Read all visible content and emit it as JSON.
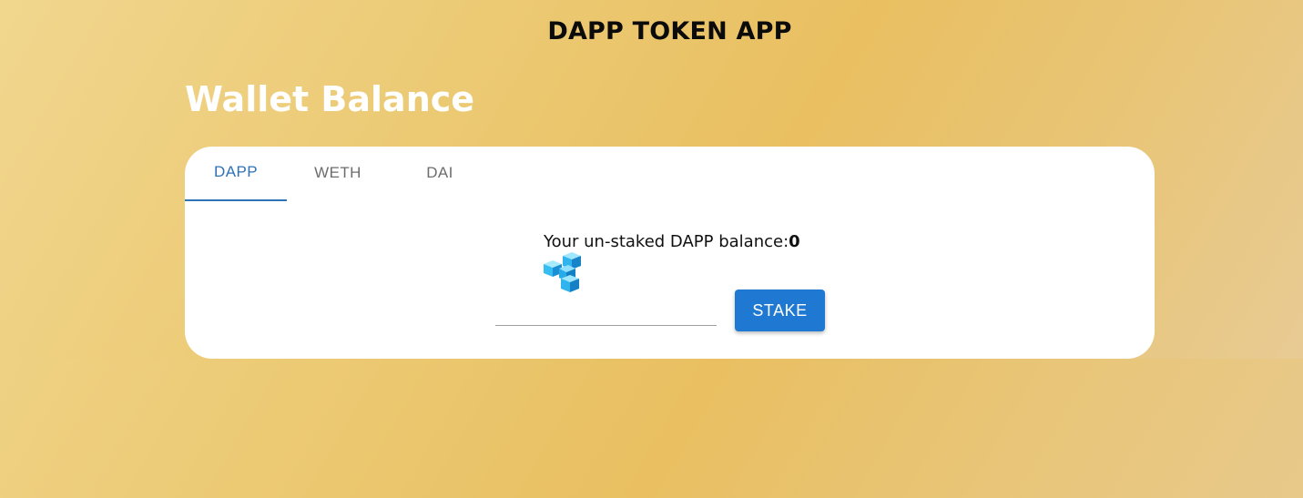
{
  "header": {
    "app_title": "DAPP TOKEN APP"
  },
  "main": {
    "heading": "Wallet Balance",
    "tabs": [
      {
        "label": "DAPP",
        "active": true
      },
      {
        "label": "WETH",
        "active": false
      },
      {
        "label": "DAI",
        "active": false
      }
    ],
    "balance": {
      "label": "Your un-staked DAPP balance:",
      "value": "0",
      "token_icon": "dapp-token-icon"
    },
    "stake": {
      "input_value": "",
      "button_label": "STAKE"
    }
  },
  "colors": {
    "accent": "#2f72b6",
    "button": "#1f78d1",
    "background": "#e9bf61"
  }
}
